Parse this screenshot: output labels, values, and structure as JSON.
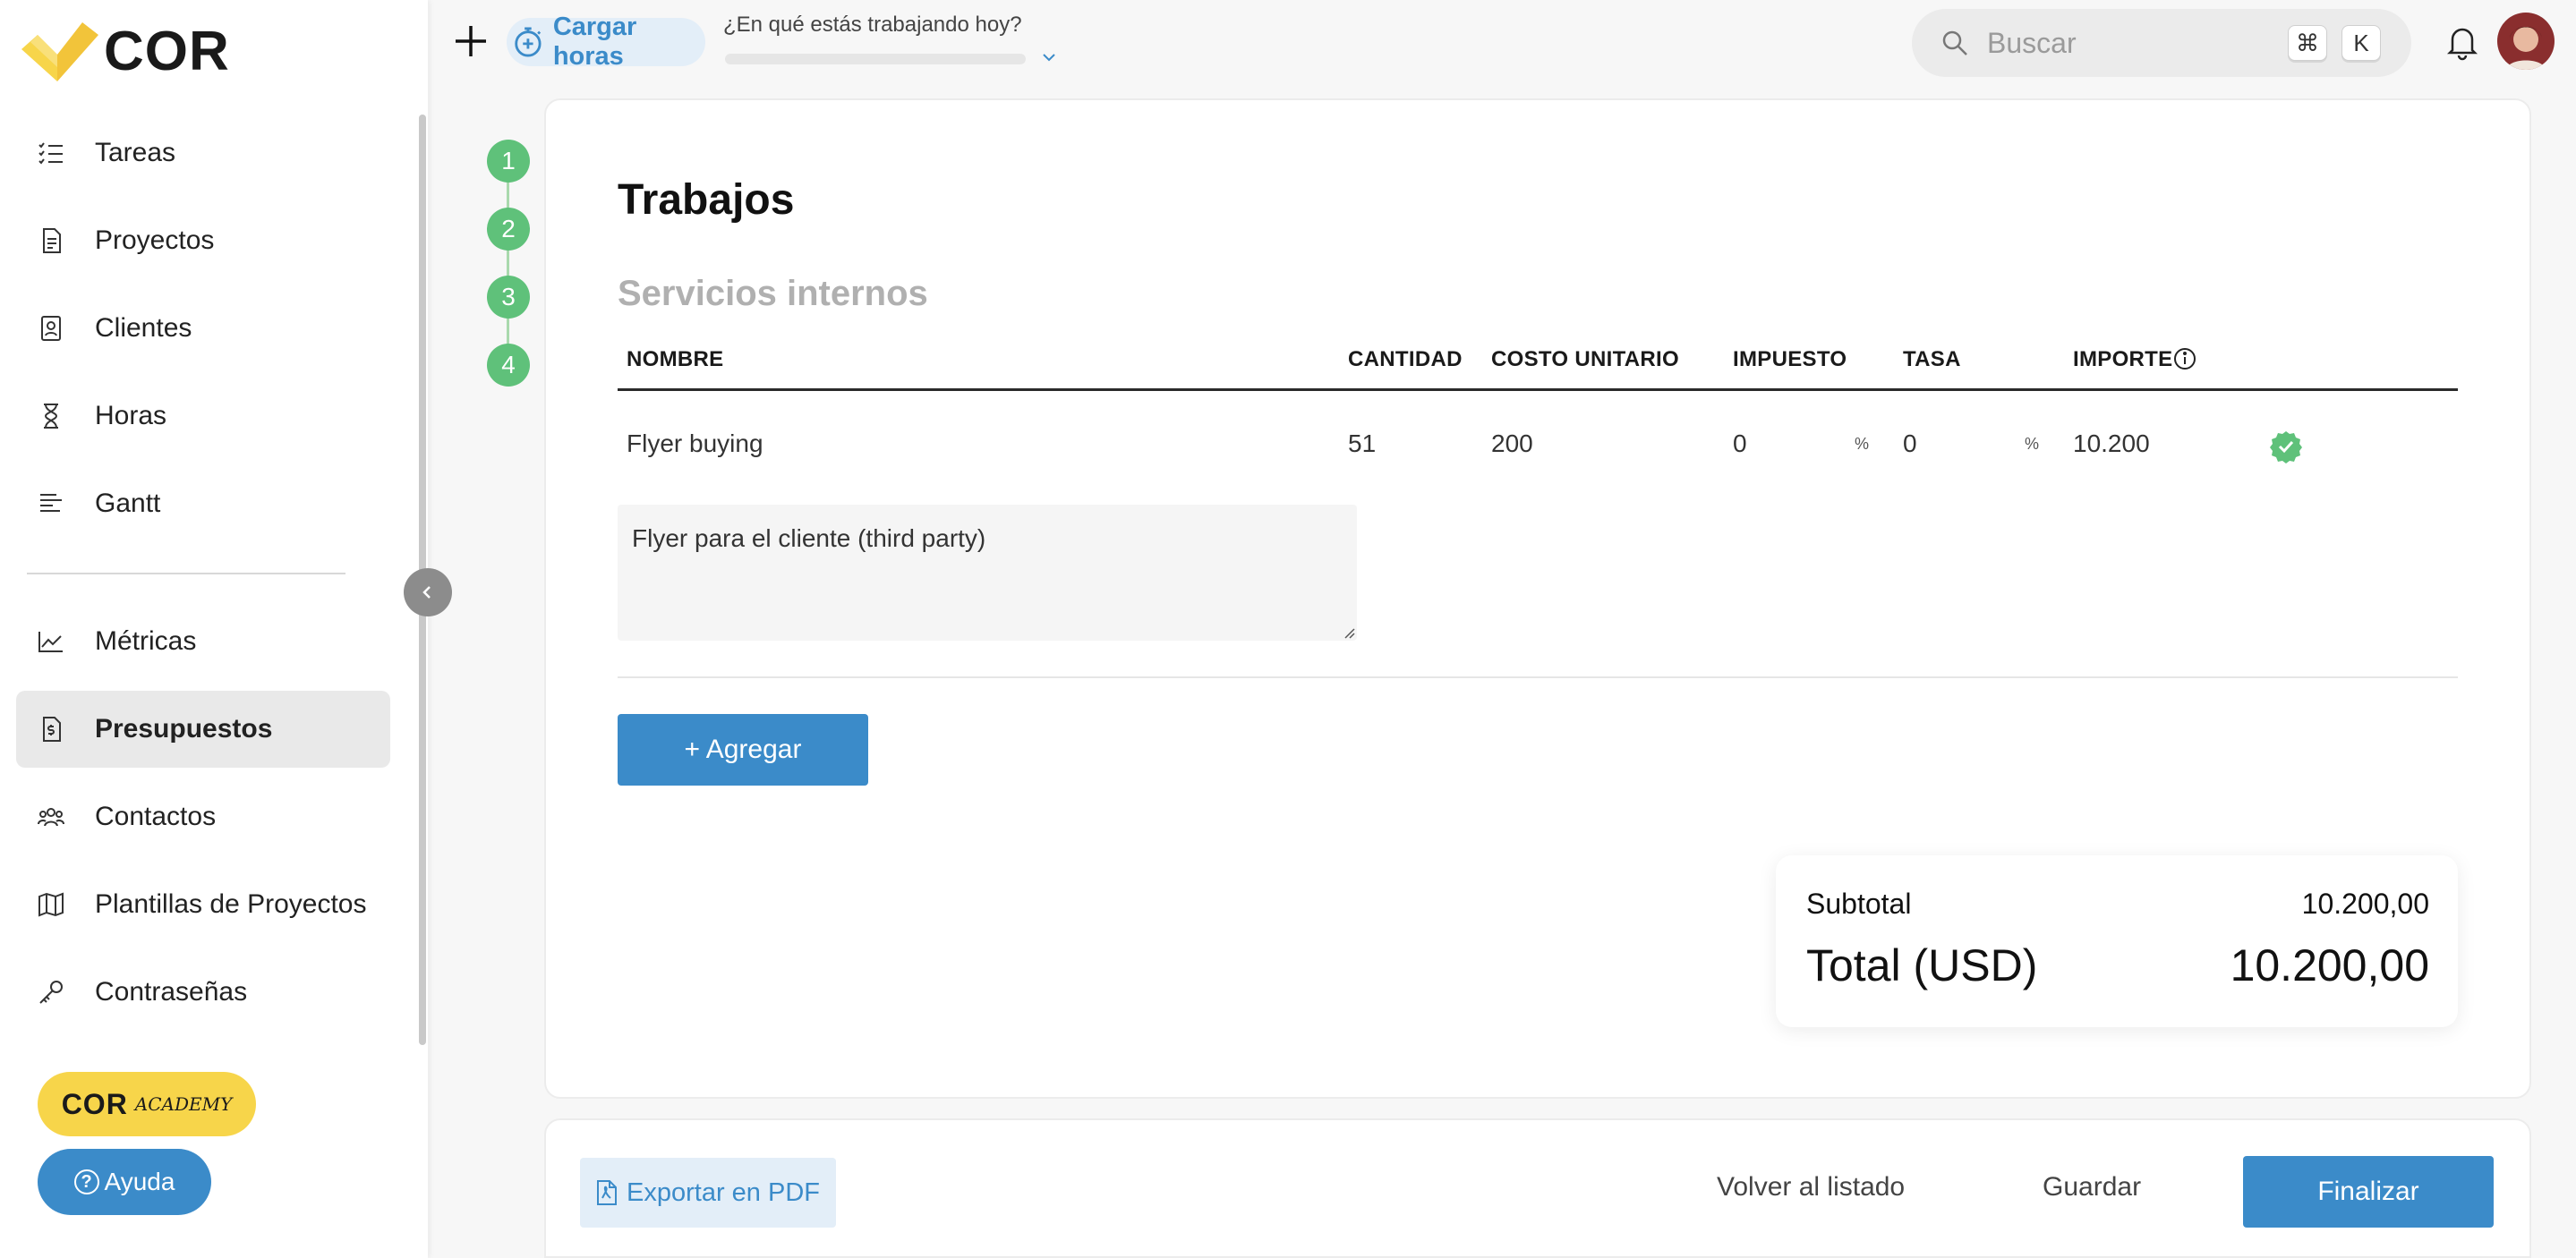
{
  "brand": {
    "logo_text": "COR",
    "accent_color": "#3b8bc9",
    "logo_color": "#f7d54a"
  },
  "sidebar": {
    "items": [
      {
        "label": "Tareas",
        "icon": "checklist-icon"
      },
      {
        "label": "Proyectos",
        "icon": "project-document-icon"
      },
      {
        "label": "Clientes",
        "icon": "client-contact-icon"
      },
      {
        "label": "Horas",
        "icon": "hourglass-icon"
      },
      {
        "label": "Gantt",
        "icon": "gantt-icon"
      },
      {
        "label": "Métricas",
        "icon": "chart-icon"
      },
      {
        "label": "Presupuestos",
        "icon": "budget-document-icon",
        "active": true
      },
      {
        "label": "Contactos",
        "icon": "people-icon"
      },
      {
        "label": "Plantillas de Proyectos",
        "icon": "map-icon"
      },
      {
        "label": "Contraseñas",
        "icon": "key-icon"
      }
    ],
    "academy_label": "COR",
    "academy_word": "ACADEMY",
    "help_label": "Ayuda"
  },
  "topbar": {
    "load_hours_label": "Cargar horas",
    "working_question": "¿En qué estás trabajando hoy?",
    "search_placeholder": "Buscar",
    "shortcut_key1": "⌘",
    "shortcut_key2": "K"
  },
  "stepper": {
    "steps": [
      "1",
      "2",
      "3",
      "4"
    ]
  },
  "main": {
    "title": "Trabajos",
    "section_title": "Servicios internos",
    "columns": [
      "NOMBRE",
      "CANTIDAD",
      "COSTO UNITARIO",
      "IMPUESTO",
      "TASA",
      "IMPORTE"
    ],
    "row": {
      "name": "Flyer buying",
      "quantity": "51",
      "unit_cost": "200",
      "tax": "0",
      "tax_unit": "%",
      "rate": "0",
      "rate_unit": "%",
      "amount": "10.200",
      "description": "Flyer para el cliente (third party)"
    },
    "add_label": "+ Agregar",
    "subtotal_label": "Subtotal",
    "subtotal_value": "10.200,00",
    "total_label": "Total (USD)",
    "total_value": "10.200,00"
  },
  "footer": {
    "export_label": "Exportar en PDF",
    "back_label": "Volver al listado",
    "save_label": "Guardar",
    "finish_label": "Finalizar"
  }
}
